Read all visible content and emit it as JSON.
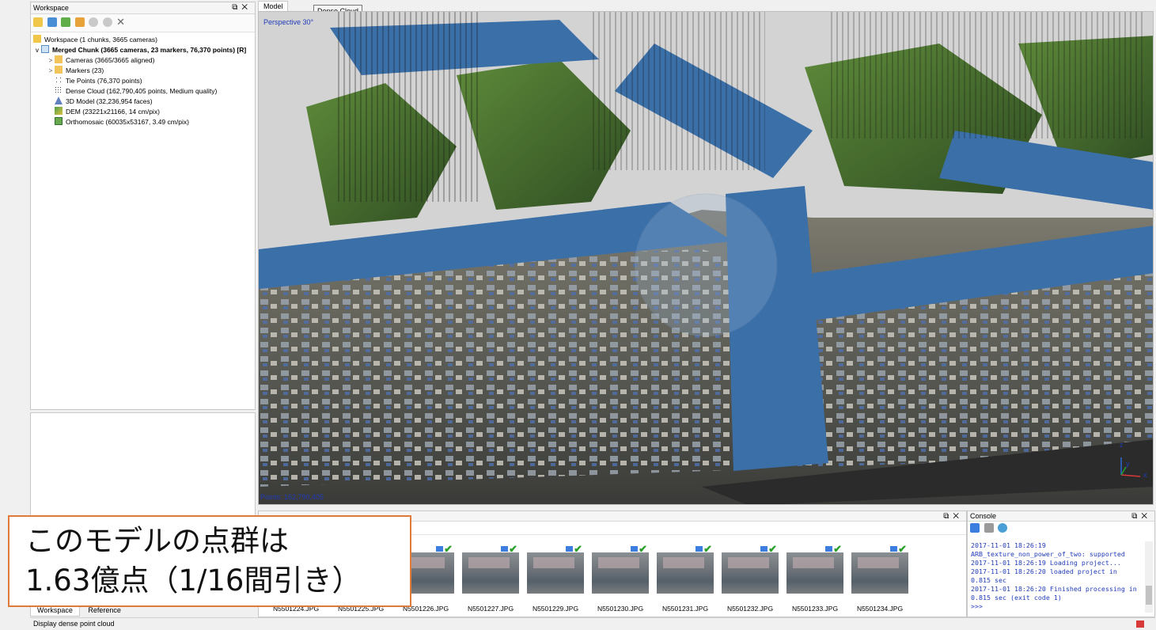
{
  "workspace": {
    "title": "Workspace",
    "tree": [
      {
        "label": "Workspace (1 chunks, 3665 cameras)",
        "icon": "workspace-icon"
      },
      {
        "label": "Merged Chunk (3665 cameras, 23 markers, 76,370 points) [R]",
        "icon": "chunk-icon"
      },
      {
        "label": "Cameras (3665/3665 aligned)",
        "icon": "folder-icon"
      },
      {
        "label": "Markers (23)",
        "icon": "folder-icon"
      },
      {
        "label": "Tie Points (76,370 points)",
        "icon": "tie-points-icon"
      },
      {
        "label": "Dense Cloud (162,790,405 points, Medium quality)",
        "icon": "dense-cloud-icon"
      },
      {
        "label": "3D Model (32,236,954 faces)",
        "icon": "model-icon"
      },
      {
        "label": "DEM (23221x21166, 14 cm/pix)",
        "icon": "dem-icon"
      },
      {
        "label": "Orthomosaic (60035x53167, 3.49 cm/pix)",
        "icon": "orthomosaic-icon"
      }
    ],
    "bottom_tabs": [
      "Workspace",
      "Reference"
    ]
  },
  "model": {
    "tab": "Model",
    "tooltip": "Dense Cloud",
    "view_label": "Perspective 30°",
    "points_label": "Points: 162,790,405",
    "axes": [
      "z",
      "y",
      "x"
    ]
  },
  "photos": {
    "labels": [
      "N5501224.JPG",
      "N5501225.JPG",
      "N5501226.JPG",
      "N5501227.JPG",
      "N5501229.JPG",
      "N5501230.JPG",
      "N5501231.JPG",
      "N5501232.JPG",
      "N5501233.JPG",
      "N5501234.JPG"
    ]
  },
  "console": {
    "title": "Console",
    "lines": [
      "2017-11-01 18:26:19",
      "ARB_texture_non_power_of_two: supported",
      "2017-11-01 18:26:19 Loading project...",
      "2017-11-01 18:26:20 loaded project in",
      "0.815 sec",
      "2017-11-01 18:26:20 Finished processing in",
      "0.815 sec (exit code 1)",
      ">>>"
    ]
  },
  "annotation": {
    "line1": "このモデルの点群は",
    "line2": "1.63億点（1/16間引き）"
  },
  "status_bar": "Display dense point cloud",
  "colors": {
    "water_blue": "#3b6fa8",
    "annotation_border": "#e07a3a",
    "console_text": "#1f3bb8"
  }
}
